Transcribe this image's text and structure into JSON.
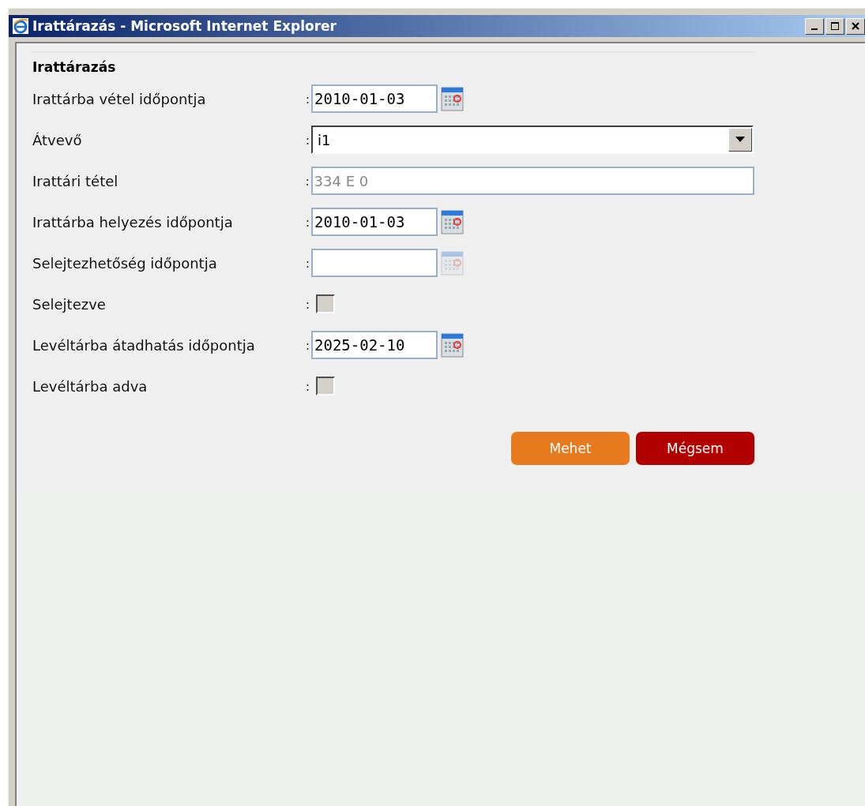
{
  "window": {
    "title": "Irattárazás - Microsoft Internet Explorer"
  },
  "form": {
    "title": "Irattárazás",
    "fields": [
      {
        "kind": "date",
        "label": "Irattárba vétel időpontja",
        "separator": ":",
        "value": "2010-01-03",
        "disabled": false
      },
      {
        "kind": "select",
        "label": "Átvevő",
        "separator": ":",
        "value": "i1",
        "disabled": false
      },
      {
        "kind": "text",
        "label": "Irattári tétel",
        "separator": ":",
        "value": "334 E 0",
        "disabled": true
      },
      {
        "kind": "date",
        "label": "Irattárba helyezés időpontja",
        "separator": ":",
        "value": "2010-01-03",
        "disabled": false
      },
      {
        "kind": "date",
        "label": "Selejtezhetőség időpontja",
        "separator": ":",
        "disabled": true
      },
      {
        "kind": "checkbox",
        "label": "Selejtezve",
        "separator": ":",
        "checked": false,
        "disabled": true
      },
      {
        "kind": "date",
        "label": "Levéltárba átadhatás időpontja",
        "separator": ":",
        "value": "2025-02-10",
        "disabled": false
      },
      {
        "kind": "checkbox",
        "label": "Levéltárba adva",
        "separator": ":",
        "checked": false,
        "disabled": true
      }
    ],
    "buttons": [
      {
        "kind": "primary",
        "label": "Mehet"
      },
      {
        "kind": "cancel",
        "label": "Mégsem"
      }
    ]
  }
}
